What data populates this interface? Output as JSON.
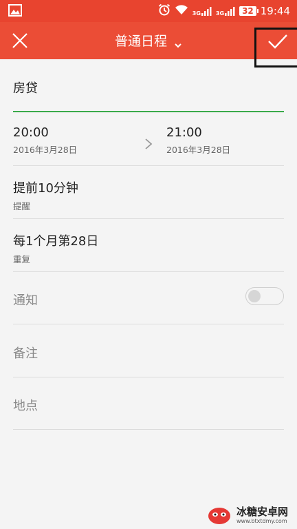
{
  "status_bar": {
    "time": "19:44",
    "battery": "32",
    "network_1": "3G",
    "network_2": "3G",
    "icons": [
      "image-icon",
      "alarm-icon",
      "wifi-icon",
      "signal-icon",
      "signal-icon",
      "battery-icon"
    ]
  },
  "toolbar": {
    "title": "普通日程",
    "close_icon": "close-icon",
    "confirm_icon": "check-icon",
    "accent": "#eb4d36"
  },
  "event": {
    "title_value": "房贷",
    "start_time": "20:00",
    "start_date": "2016年3月28日",
    "end_time": "21:00",
    "end_date": "2016年3月28日",
    "reminder_value": "提前10分钟",
    "reminder_label": "提醒",
    "repeat_value": "每1个月第28日",
    "repeat_label": "重复",
    "notify_label": "通知",
    "notify_on": false,
    "note_placeholder": "备注",
    "location_placeholder": "地点"
  },
  "watermark": {
    "name": "冰糖安卓网",
    "url": "www.btxtdmy.com"
  }
}
